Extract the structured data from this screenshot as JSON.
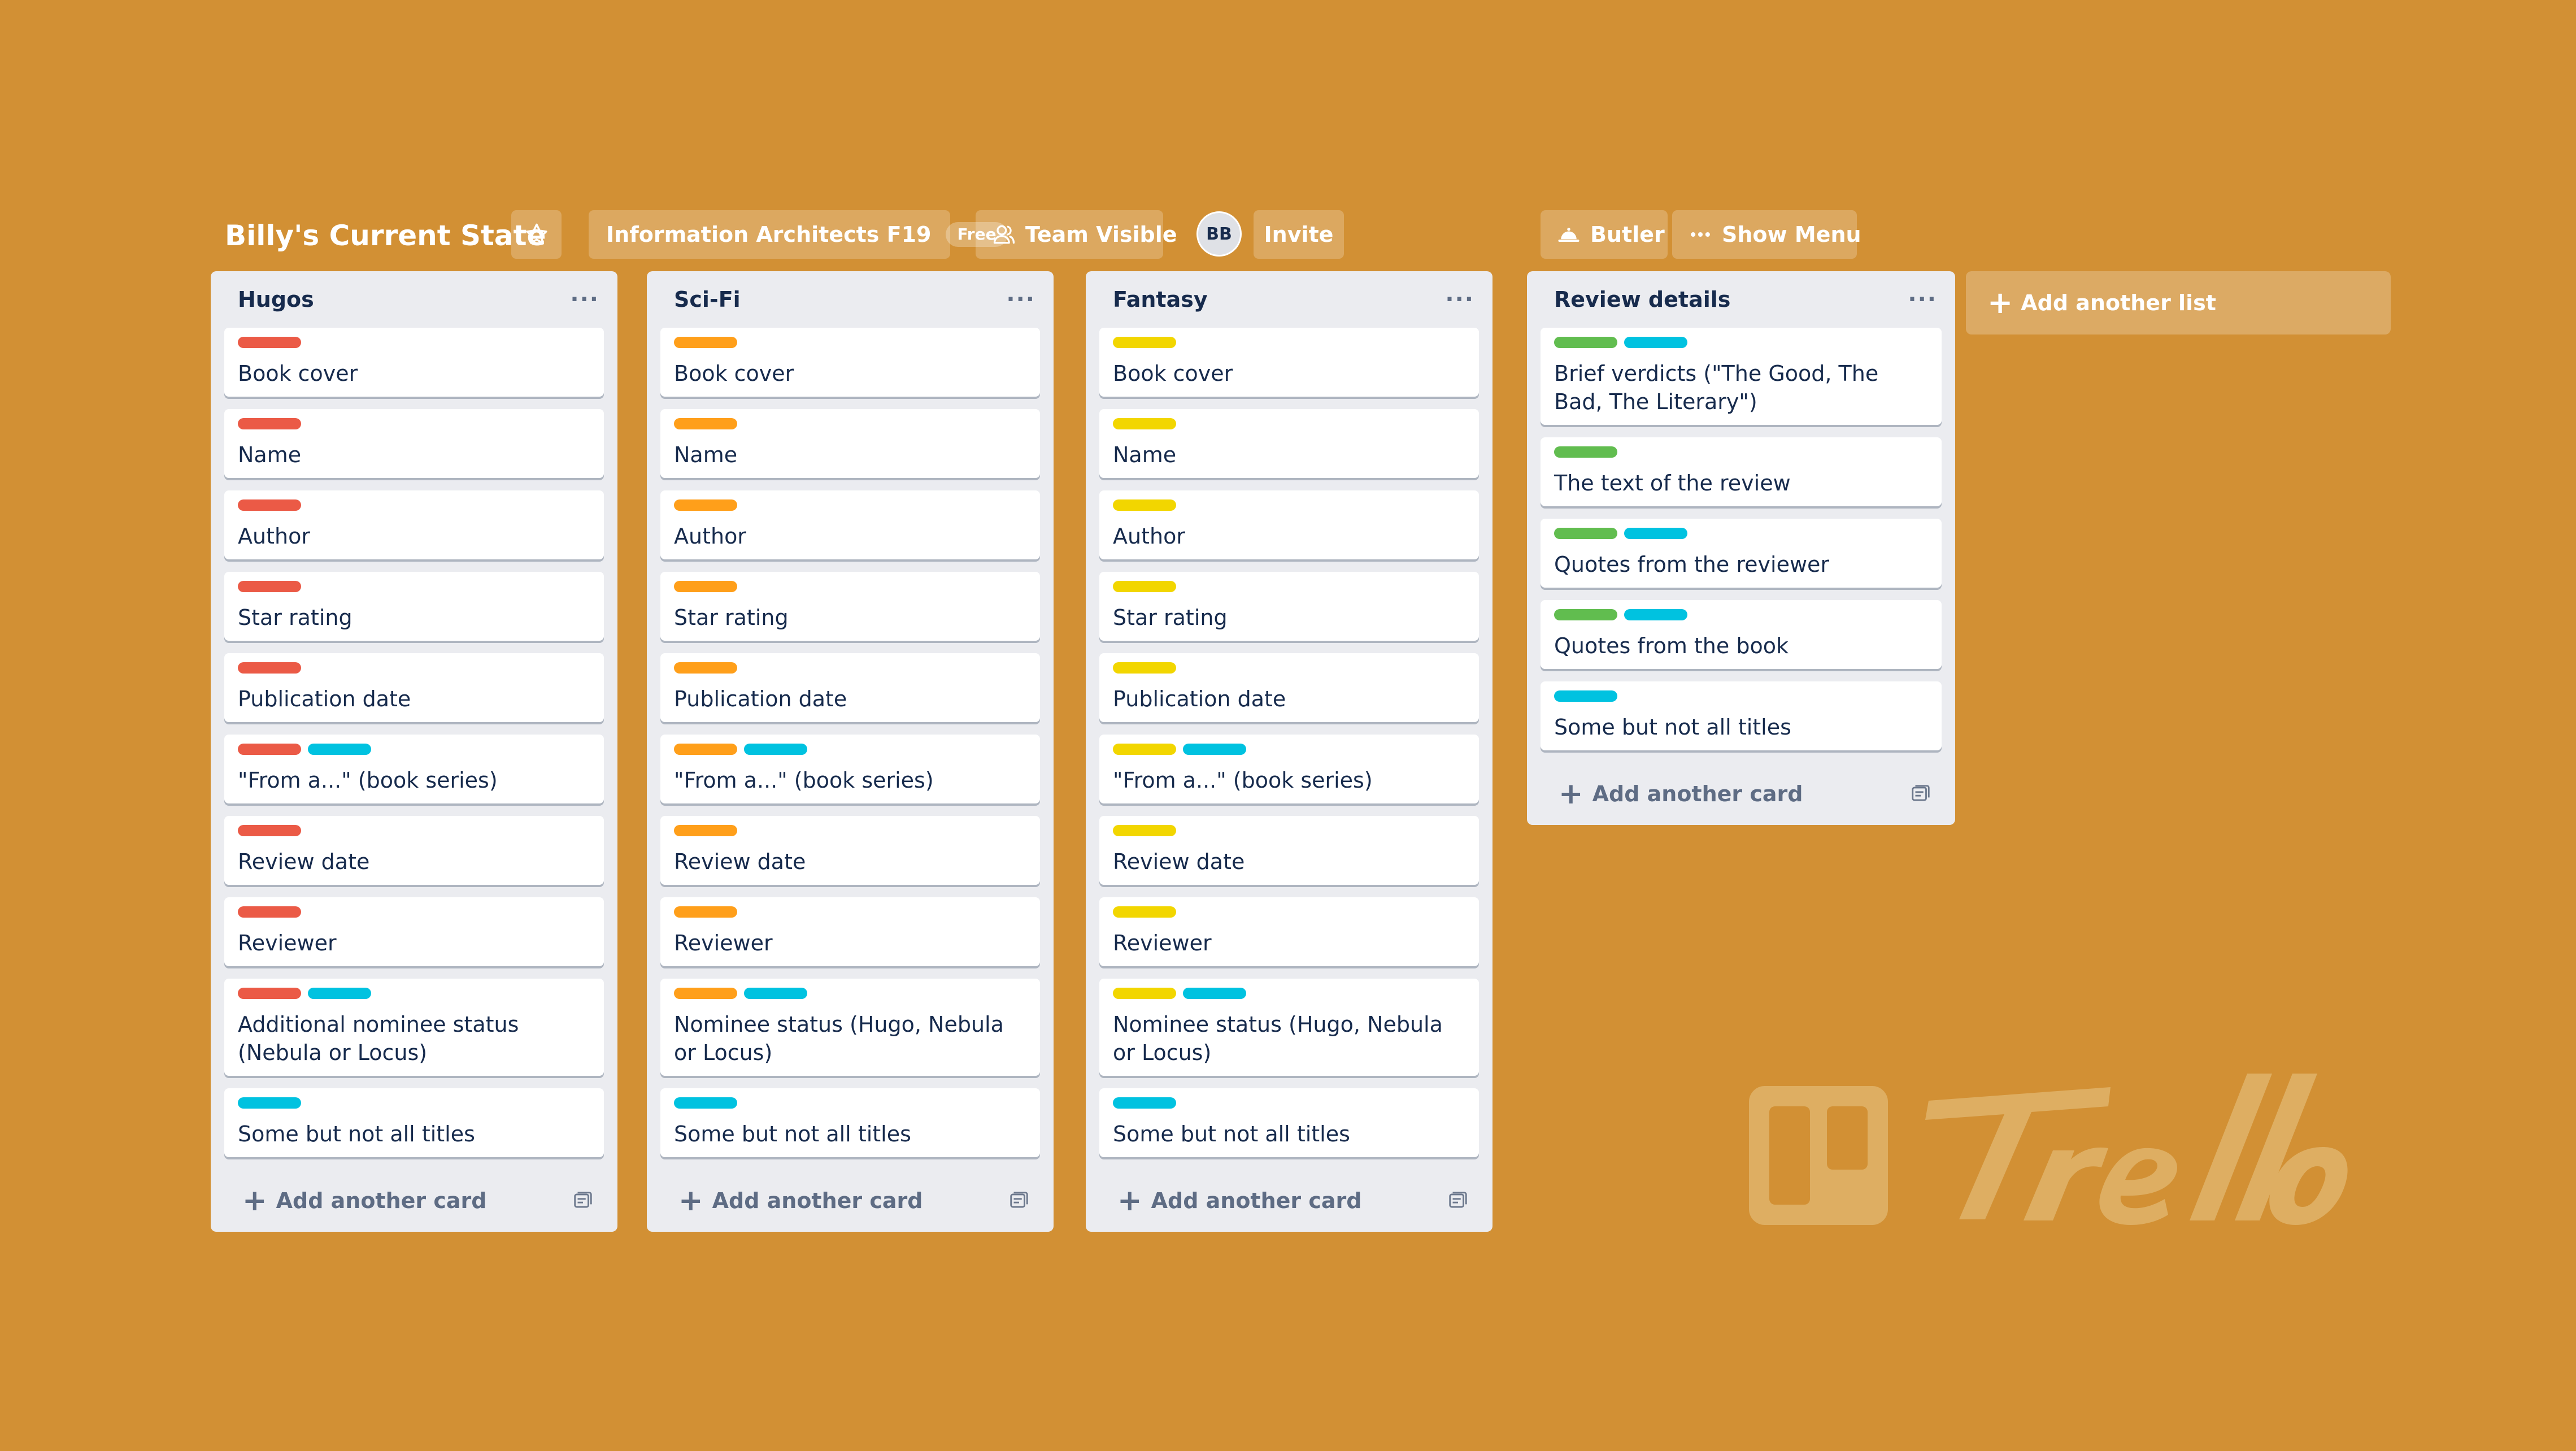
{
  "header": {
    "board_title": "Billy's Current State",
    "team_name": "Information Architects F19",
    "team_badge": "Free",
    "visibility": "Team Visible",
    "avatar_initials": "BB",
    "invite": "Invite",
    "butler": "Butler",
    "show_menu": "Show Menu"
  },
  "colors": {
    "background": "#d29034",
    "red": "#eb5a46",
    "orange": "#ff9f1a",
    "yellow": "#f2d600",
    "green": "#61bd4f",
    "sky": "#00c2e0"
  },
  "lists": [
    {
      "title": "Hugos",
      "cards": [
        {
          "title": "Book cover",
          "labels": [
            "red"
          ]
        },
        {
          "title": "Name",
          "labels": [
            "red"
          ]
        },
        {
          "title": "Author",
          "labels": [
            "red"
          ]
        },
        {
          "title": "Star rating",
          "labels": [
            "red"
          ]
        },
        {
          "title": "Publication date",
          "labels": [
            "red"
          ]
        },
        {
          "title": "\"From a...\" (book series)",
          "labels": [
            "red",
            "sky"
          ]
        },
        {
          "title": "Review date",
          "labels": [
            "red"
          ]
        },
        {
          "title": "Reviewer",
          "labels": [
            "red"
          ]
        },
        {
          "title": "Additional nominee status (Nebula or Locus)",
          "labels": [
            "red",
            "sky"
          ]
        },
        {
          "title": "Some but not all titles",
          "labels": [
            "sky"
          ]
        }
      ],
      "add_card": "Add another card"
    },
    {
      "title": "Sci-Fi",
      "cards": [
        {
          "title": "Book cover",
          "labels": [
            "orange"
          ]
        },
        {
          "title": "Name",
          "labels": [
            "orange"
          ]
        },
        {
          "title": "Author",
          "labels": [
            "orange"
          ]
        },
        {
          "title": "Star rating",
          "labels": [
            "orange"
          ]
        },
        {
          "title": "Publication date",
          "labels": [
            "orange"
          ]
        },
        {
          "title": "\"From a...\" (book series)",
          "labels": [
            "orange",
            "sky"
          ]
        },
        {
          "title": "Review date",
          "labels": [
            "orange"
          ]
        },
        {
          "title": "Reviewer",
          "labels": [
            "orange"
          ]
        },
        {
          "title": "Nominee status (Hugo, Nebula or Locus)",
          "labels": [
            "orange",
            "sky"
          ]
        },
        {
          "title": "Some but not all titles",
          "labels": [
            "sky"
          ]
        }
      ],
      "add_card": "Add another card"
    },
    {
      "title": "Fantasy",
      "cards": [
        {
          "title": "Book cover",
          "labels": [
            "yellow"
          ]
        },
        {
          "title": "Name",
          "labels": [
            "yellow"
          ]
        },
        {
          "title": "Author",
          "labels": [
            "yellow"
          ]
        },
        {
          "title": "Star rating",
          "labels": [
            "yellow"
          ]
        },
        {
          "title": "Publication date",
          "labels": [
            "yellow"
          ]
        },
        {
          "title": "\"From a...\" (book series)",
          "labels": [
            "yellow",
            "sky"
          ]
        },
        {
          "title": "Review date",
          "labels": [
            "yellow"
          ]
        },
        {
          "title": "Reviewer",
          "labels": [
            "yellow"
          ]
        },
        {
          "title": "Nominee status (Hugo, Nebula or Locus)",
          "labels": [
            "yellow",
            "sky"
          ]
        },
        {
          "title": "Some but not all titles",
          "labels": [
            "sky"
          ]
        }
      ],
      "add_card": "Add another card"
    },
    {
      "title": "Review details",
      "cards": [
        {
          "title": "Brief verdicts (\"The Good, The Bad, The Literary\")",
          "labels": [
            "green",
            "sky"
          ]
        },
        {
          "title": "The text of the review",
          "labels": [
            "green"
          ]
        },
        {
          "title": "Quotes from the reviewer",
          "labels": [
            "green",
            "sky"
          ]
        },
        {
          "title": "Quotes from the book",
          "labels": [
            "green",
            "sky"
          ]
        },
        {
          "title": "Some but not all titles",
          "labels": [
            "sky"
          ]
        }
      ],
      "add_card": "Add another card"
    }
  ],
  "add_list": "Add another list",
  "logo": {
    "wordmark": "Trello"
  }
}
